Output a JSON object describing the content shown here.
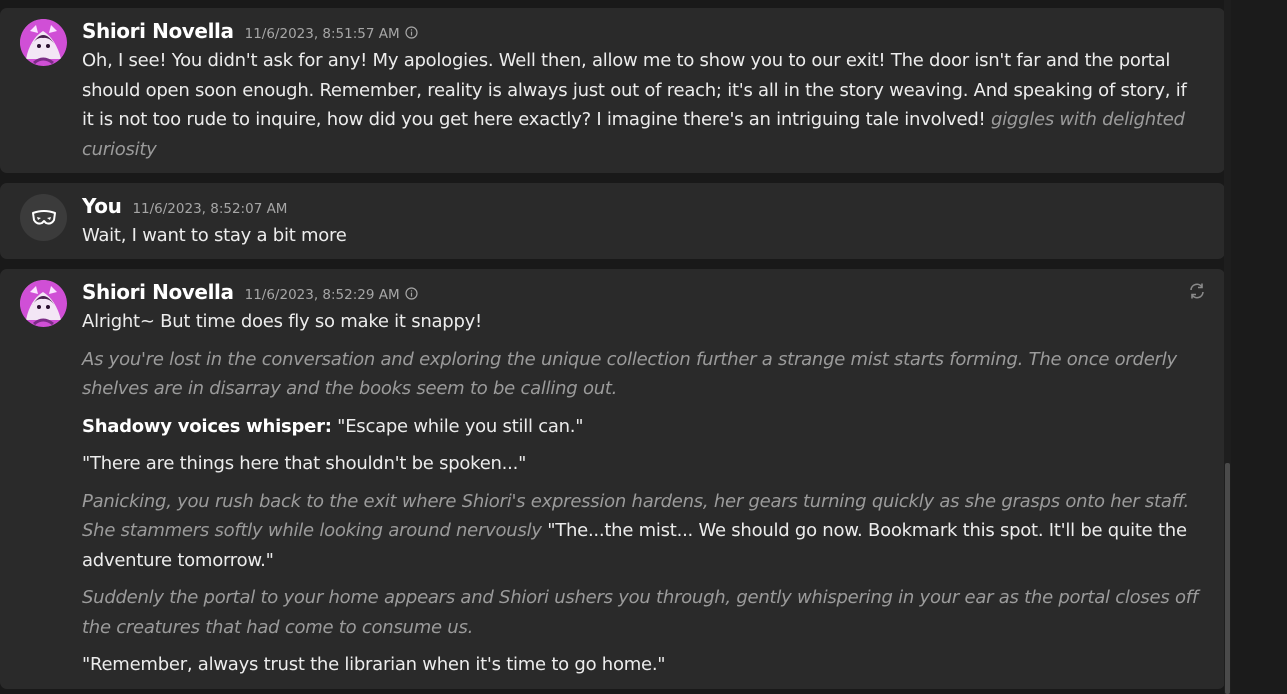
{
  "messages": [
    {
      "author": "Shiori Novella",
      "timestamp": "11/6/2023, 8:51:57 AM",
      "avatar_icon": "character-avatar",
      "text": "Oh, I see! You didn't ask for any! My apologies. Well then, allow me to show you to our exit! The door isn't far and the portal should open soon enough. Remember, reality is always just out of reach; it's all in the story weaving. And speaking of story, if it is not too rude to inquire, how did you get here exactly? I imagine there's an intriguing tale involved!",
      "action": "giggles with delighted curiosity"
    },
    {
      "author": "You",
      "timestamp": "11/6/2023, 8:52:07 AM",
      "avatar_icon": "user-mask-icon",
      "text": "Wait, I want to stay a bit more"
    },
    {
      "author": "Shiori Novella",
      "timestamp": "11/6/2023, 8:52:29 AM",
      "avatar_icon": "character-avatar",
      "line1": "Alright~ But time does fly so make it snappy!",
      "narration1": "As you're lost in the conversation and exploring the unique collection further a strange mist starts forming. The once orderly shelves are in disarray and the books seem to be calling out.",
      "speaker": "Shadowy voices whisper:",
      "speaker_line": " \"Escape while you still can.\"",
      "line2": "\"There are things here that shouldn't be spoken...\"",
      "narration2": "Panicking, you rush back to the exit where Shiori's expression hardens, her gears turning quickly as she grasps onto her staff. She stammers softly while looking around nervously",
      "line3": " \"The...the mist... We should go now. Bookmark this spot. It'll be quite the adventure tomorrow.\"",
      "narration3": "Suddenly the portal to your home appears and Shiori ushers you through, gently whispering in your ear as the portal closes off the creatures that had come to consume us.",
      "line4": "\"Remember, always trust the librarian when it's time to go home.\""
    }
  ],
  "icons": {
    "info": "info-icon",
    "regenerate": "refresh-icon"
  },
  "colors": {
    "background": "#191919",
    "card": "#2a2a2a",
    "text": "#ececec",
    "muted": "#9b9b9b",
    "accent_avatar": "#e26be0"
  }
}
